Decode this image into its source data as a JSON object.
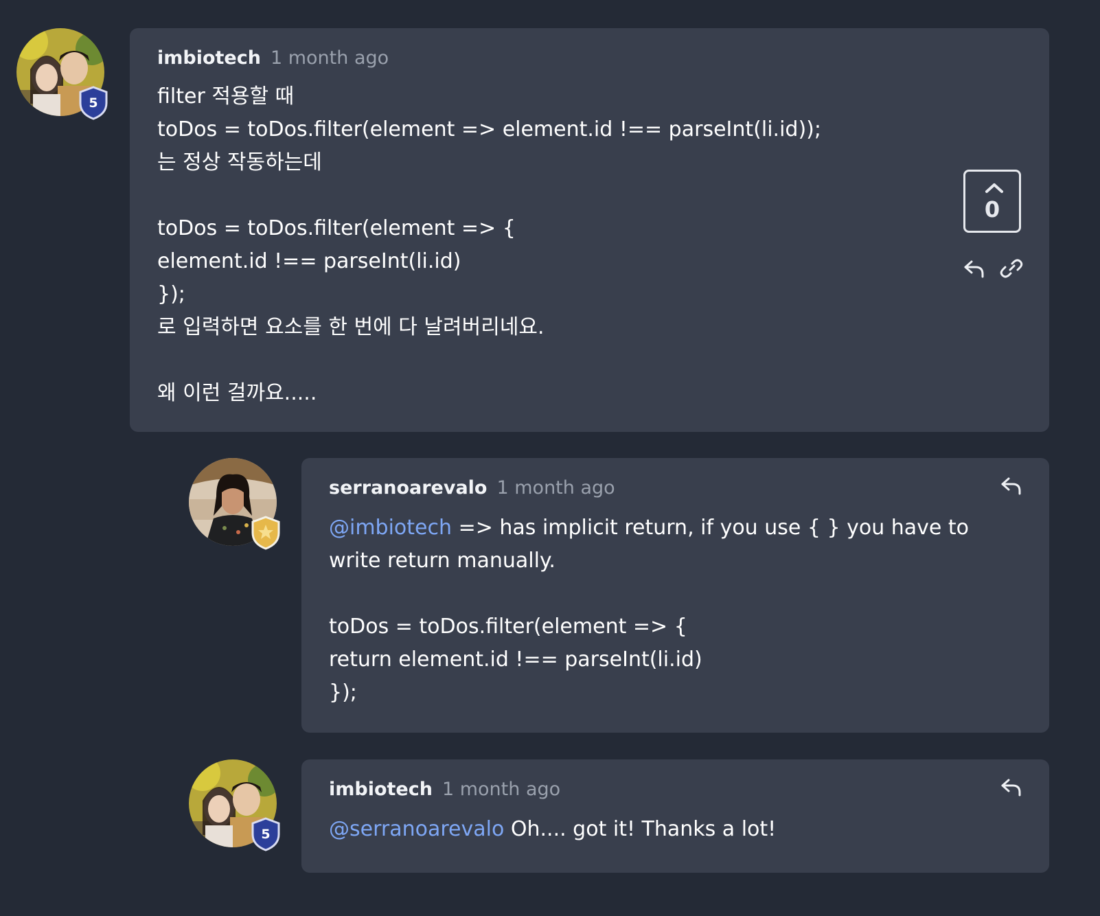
{
  "comments": [
    {
      "username": "imbiotech",
      "time": "1 month ago",
      "level_badge": "5",
      "body": "filter 적용할 때\ntoDos = toDos.filter(element => element.id !== parseInt(li.id));\n는 정상 작동하는데\n\ntoDos = toDos.filter(element => {\nelement.id !== parseInt(li.id)\n});\n로 입력하면 요소를 한 번에 다 날려버리네요.\n\n왜 이런 걸까요.....",
      "vote_count": "0"
    },
    {
      "username": "serranoarevalo",
      "time": "1 month ago",
      "mention": "@imbiotech",
      "body_first_line_rest": " => has implicit return, if you use { } you have to",
      "body_rest": "write return manually.\n\ntoDos = toDos.filter(element => {\nreturn element.id !== parseInt(li.id)\n});"
    },
    {
      "username": "imbiotech",
      "time": "1 month ago",
      "level_badge": "5",
      "mention": "@serranoarevalo",
      "body_rest": " Oh.... got it! Thanks a lot!"
    }
  ],
  "icons": {
    "upvote": "chevron-up-icon",
    "reply": "reply-icon",
    "link": "link-icon",
    "badge_level": "shield-badge-icon",
    "badge_star": "star-shield-badge-icon"
  },
  "colors": {
    "background": "#242a36",
    "card": "#393f4d",
    "mention": "#7ea7f5",
    "badge_blue": "#2c3f9a"
  }
}
